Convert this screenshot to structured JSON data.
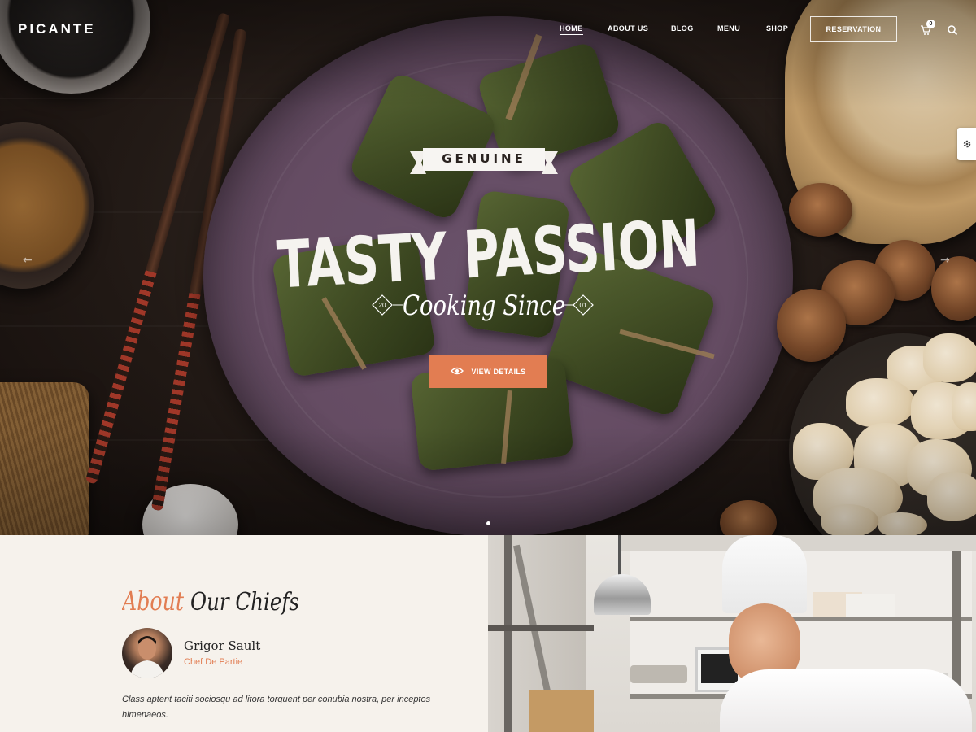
{
  "header": {
    "logo": "PICANTE",
    "nav": [
      {
        "label": "HOME",
        "active": true
      },
      {
        "label": "ABOUT US",
        "active": false
      },
      {
        "label": "BLOG",
        "active": false
      },
      {
        "label": "MENU",
        "active": false
      },
      {
        "label": "SHOP",
        "active": false
      }
    ],
    "reservation_label": "RESERVATION",
    "cart_count": "0",
    "icons": {
      "cart": "cart-icon",
      "search": "search-icon",
      "settings": "gear-icon"
    }
  },
  "hero": {
    "ribbon_text": "GENUINE",
    "headline": "TASTY PASSION",
    "subline": "Cooking Since",
    "year_left": "20",
    "year_right": "01",
    "cta_label": "VIEW DETAILS",
    "cta_icon": "eye-icon"
  },
  "about": {
    "title_accent": "About",
    "title_rest": "Our Chiefs",
    "chef": {
      "name": "Grigor Sault",
      "role": "Chef De Partie",
      "description": "Class aptent taciti sociosqu ad litora torquent per conubia nostra, per inceptos himenaeos."
    }
  },
  "colors": {
    "accent": "#e27d52",
    "section_bg": "#f6f2ec",
    "text_dark": "#222222"
  }
}
